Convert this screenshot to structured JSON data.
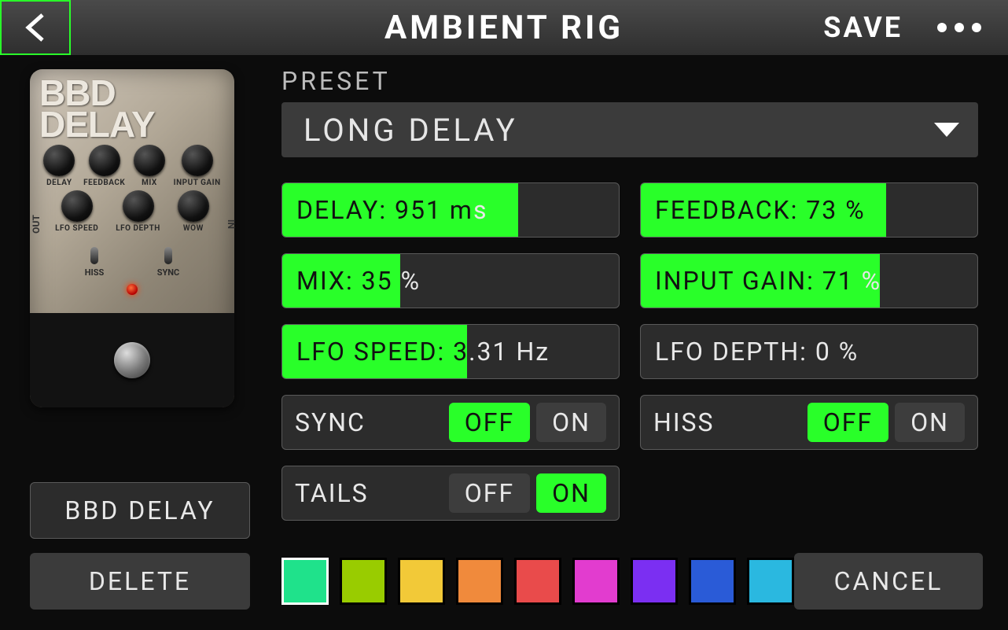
{
  "header": {
    "title": "AMBIENT RIG",
    "save_label": "SAVE"
  },
  "pedal": {
    "brand_line1": "BBD",
    "brand_line2": "DELAY",
    "knob_labels_row1": [
      "DELAY",
      "FEEDBACK",
      "MIX",
      "INPUT GAIN"
    ],
    "knob_labels_row2": [
      "LFO SPEED",
      "LFO DEPTH",
      "WOW"
    ],
    "switch_labels": [
      "HISS",
      "SYNC"
    ],
    "side_out": "OUT",
    "side_in": "IN"
  },
  "preset": {
    "label": "PRESET",
    "value": "LONG DELAY"
  },
  "params": {
    "delay": {
      "text": "DELAY: 951 ms",
      "fill_pct": 70,
      "black_chars": 12
    },
    "feedback": {
      "text": "FEEDBACK: 73 %",
      "fill_pct": 73,
      "black_chars": 14
    },
    "mix": {
      "text": "MIX: 35 %",
      "fill_pct": 35,
      "black_chars": 7
    },
    "input_gain": {
      "text": "INPUT GAIN: 71 %",
      "fill_pct": 71,
      "black_chars": 14
    },
    "lfo_speed": {
      "text": "LFO SPEED: 3.31 Hz",
      "fill_pct": 55,
      "black_chars": 12
    },
    "lfo_depth": {
      "text": "LFO DEPTH: 0 %",
      "fill_pct": 0,
      "black_chars": 0
    }
  },
  "switches": {
    "sync": {
      "label": "SYNC",
      "off": "OFF",
      "on": "ON",
      "active": "off"
    },
    "hiss": {
      "label": "HISS",
      "off": "OFF",
      "on": "ON",
      "active": "off"
    },
    "tails": {
      "label": "TAILS",
      "off": "OFF",
      "on": "ON",
      "active": "on"
    }
  },
  "footer": {
    "effect_name": "BBD DELAY",
    "delete_label": "DELETE",
    "cancel_label": "CANCEL"
  },
  "colors": {
    "selected_index": 0,
    "swatches": [
      "#1fe28b",
      "#99cc00",
      "#f2c938",
      "#f08a3c",
      "#e94b4b",
      "#e23ccf",
      "#7b2ff2",
      "#2a5bd7",
      "#2ab8e0"
    ]
  }
}
